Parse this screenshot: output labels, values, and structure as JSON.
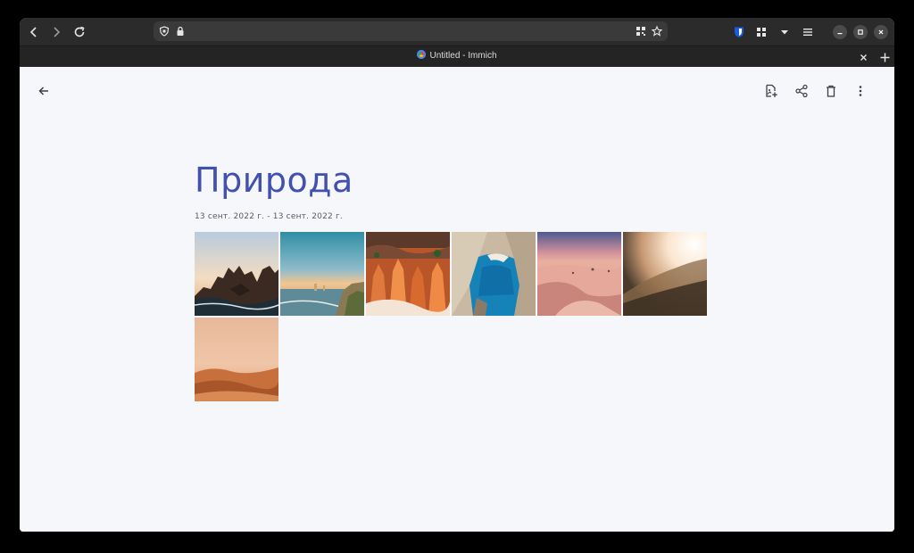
{
  "browser": {
    "tab_title": "Untitled - Immich",
    "url": "",
    "icons": {
      "back": "arrow-left-icon",
      "forward": "arrow-right-icon",
      "reload": "reload-icon",
      "shield": "shield-icon",
      "lock": "lock-icon",
      "qr": "qr-code-icon",
      "star": "star-icon",
      "bitwarden": "bitwarden-icon",
      "extensions": "extensions-icon",
      "dropdown": "chevron-down-icon",
      "menu": "hamburger-menu-icon",
      "minimize": "minimize-icon",
      "maximize": "maximize-icon",
      "close": "close-icon",
      "tab_close": "close-icon",
      "new_tab": "plus-icon"
    }
  },
  "album": {
    "title": "Природа",
    "date_range": "13 сент. 2022 г. - 13 сент. 2022 г.",
    "actions": [
      "add-photos-icon",
      "share-icon",
      "delete-icon",
      "more-vertical-icon"
    ],
    "back_icon": "arrow-left-icon",
    "photos": [
      {
        "subject": "rocky coast at sunset"
      },
      {
        "subject": "sea cliffs at dusk"
      },
      {
        "subject": "red canyon hoodoos"
      },
      {
        "subject": "turquoise bay with cliffs"
      },
      {
        "subject": "pink sand dunes"
      },
      {
        "subject": "hazy sunlit hillside"
      },
      {
        "subject": "orange desert dunes"
      }
    ]
  },
  "colors": {
    "title": "#4250af",
    "background": "#f6f7fb",
    "toolbar": "#2b2b2b"
  }
}
